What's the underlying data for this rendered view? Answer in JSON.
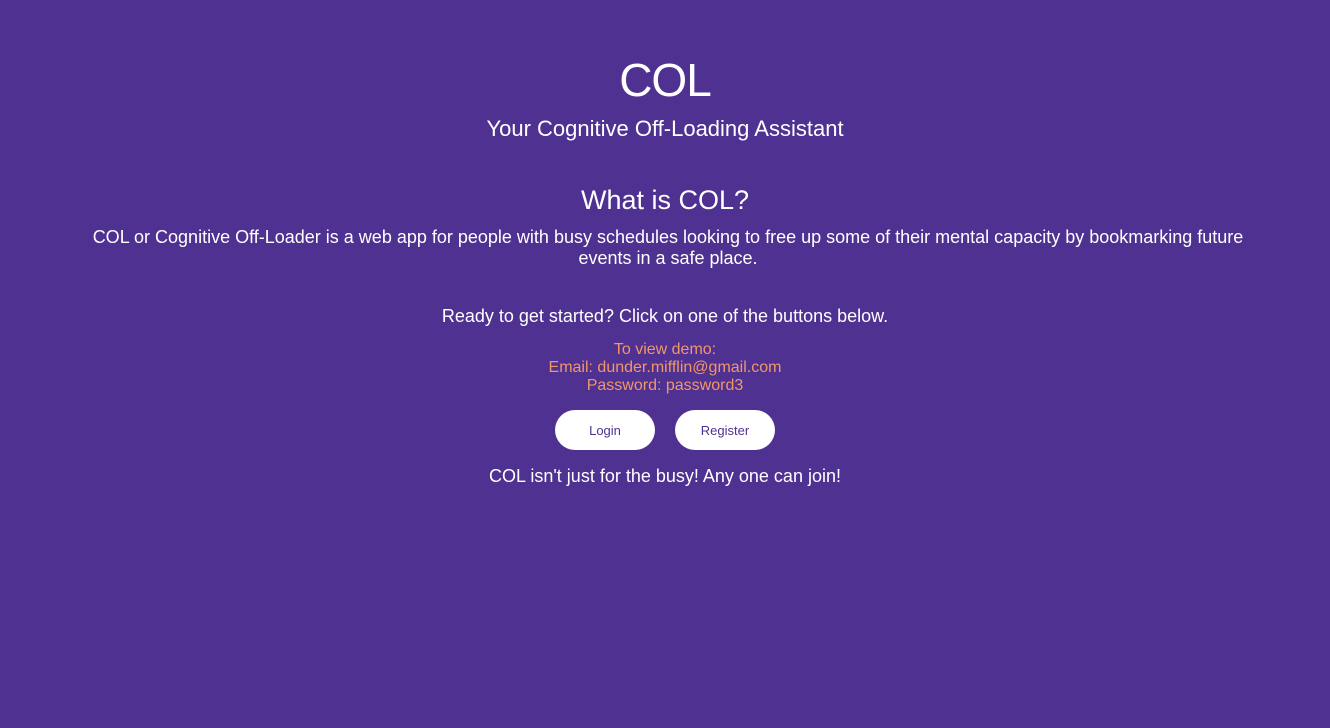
{
  "header": {
    "title": "COL",
    "subtitle": "Your Cognitive Off-Loading Assistant"
  },
  "about": {
    "heading": "What is COL?",
    "description": "COL or Cognitive Off-Loader is a web app for people with busy schedules looking to free up some of their mental capacity by bookmarking future events in a safe place."
  },
  "cta": {
    "text": "Ready to get started? Click on one of the buttons below."
  },
  "demo": {
    "heading": "To view demo:",
    "email": "Email: dunder.mifflin@gmail.com",
    "password": "Password: password3"
  },
  "buttons": {
    "login_label": "Login",
    "register_label": "Register"
  },
  "footer": {
    "text": "COL isn't just for the busy! Any one can join!"
  },
  "colors": {
    "background": "#4e3190",
    "accent": "#f2966a",
    "text": "#ffffff"
  }
}
